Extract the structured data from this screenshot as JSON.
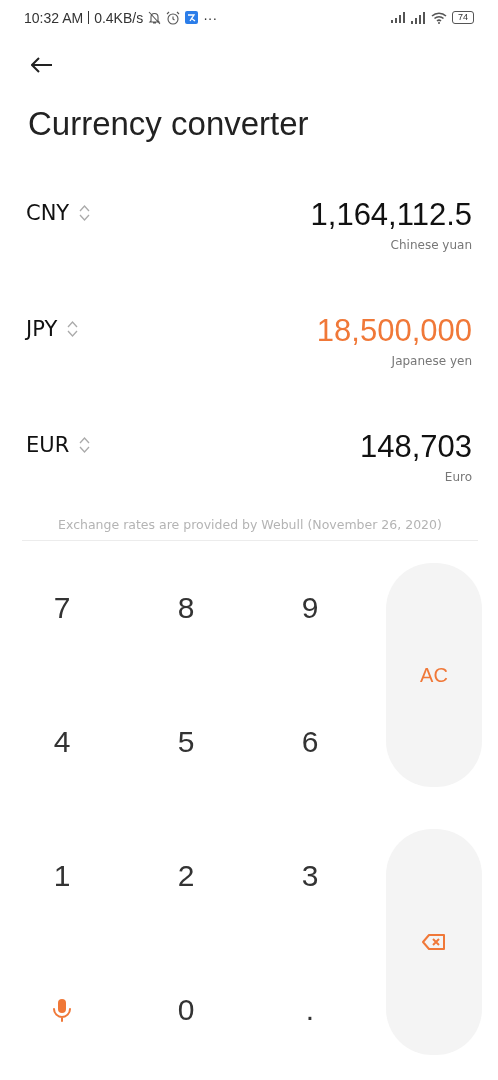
{
  "status_bar": {
    "time": "10:32 AM",
    "speed": "0.4KB/s",
    "more": "···",
    "battery": "74"
  },
  "title": "Currency converter",
  "currencies": [
    {
      "code": "CNY",
      "amount": "1,164,112.5",
      "name": "Chinese yuan",
      "selected": false
    },
    {
      "code": "JPY",
      "amount": "18,500,000",
      "name": "Japanese yen",
      "selected": true
    },
    {
      "code": "EUR",
      "amount": "148,703",
      "name": "Euro",
      "selected": false
    }
  ],
  "note": "Exchange rates are provided by Webull (November 26, 2020)",
  "keypad": [
    {
      "kind": "digit",
      "label": "7"
    },
    {
      "kind": "digit",
      "label": "8"
    },
    {
      "kind": "digit",
      "label": "9"
    },
    {
      "kind": "clear",
      "label": "AC"
    },
    {
      "kind": "digit",
      "label": "4"
    },
    {
      "kind": "digit",
      "label": "5"
    },
    {
      "kind": "digit",
      "label": "6"
    },
    {
      "kind": "digit",
      "label": "1"
    },
    {
      "kind": "digit",
      "label": "2"
    },
    {
      "kind": "digit",
      "label": "3"
    },
    {
      "kind": "backspace"
    },
    {
      "kind": "mic"
    },
    {
      "kind": "digit",
      "label": "0"
    },
    {
      "kind": "digit",
      "label": "."
    }
  ]
}
